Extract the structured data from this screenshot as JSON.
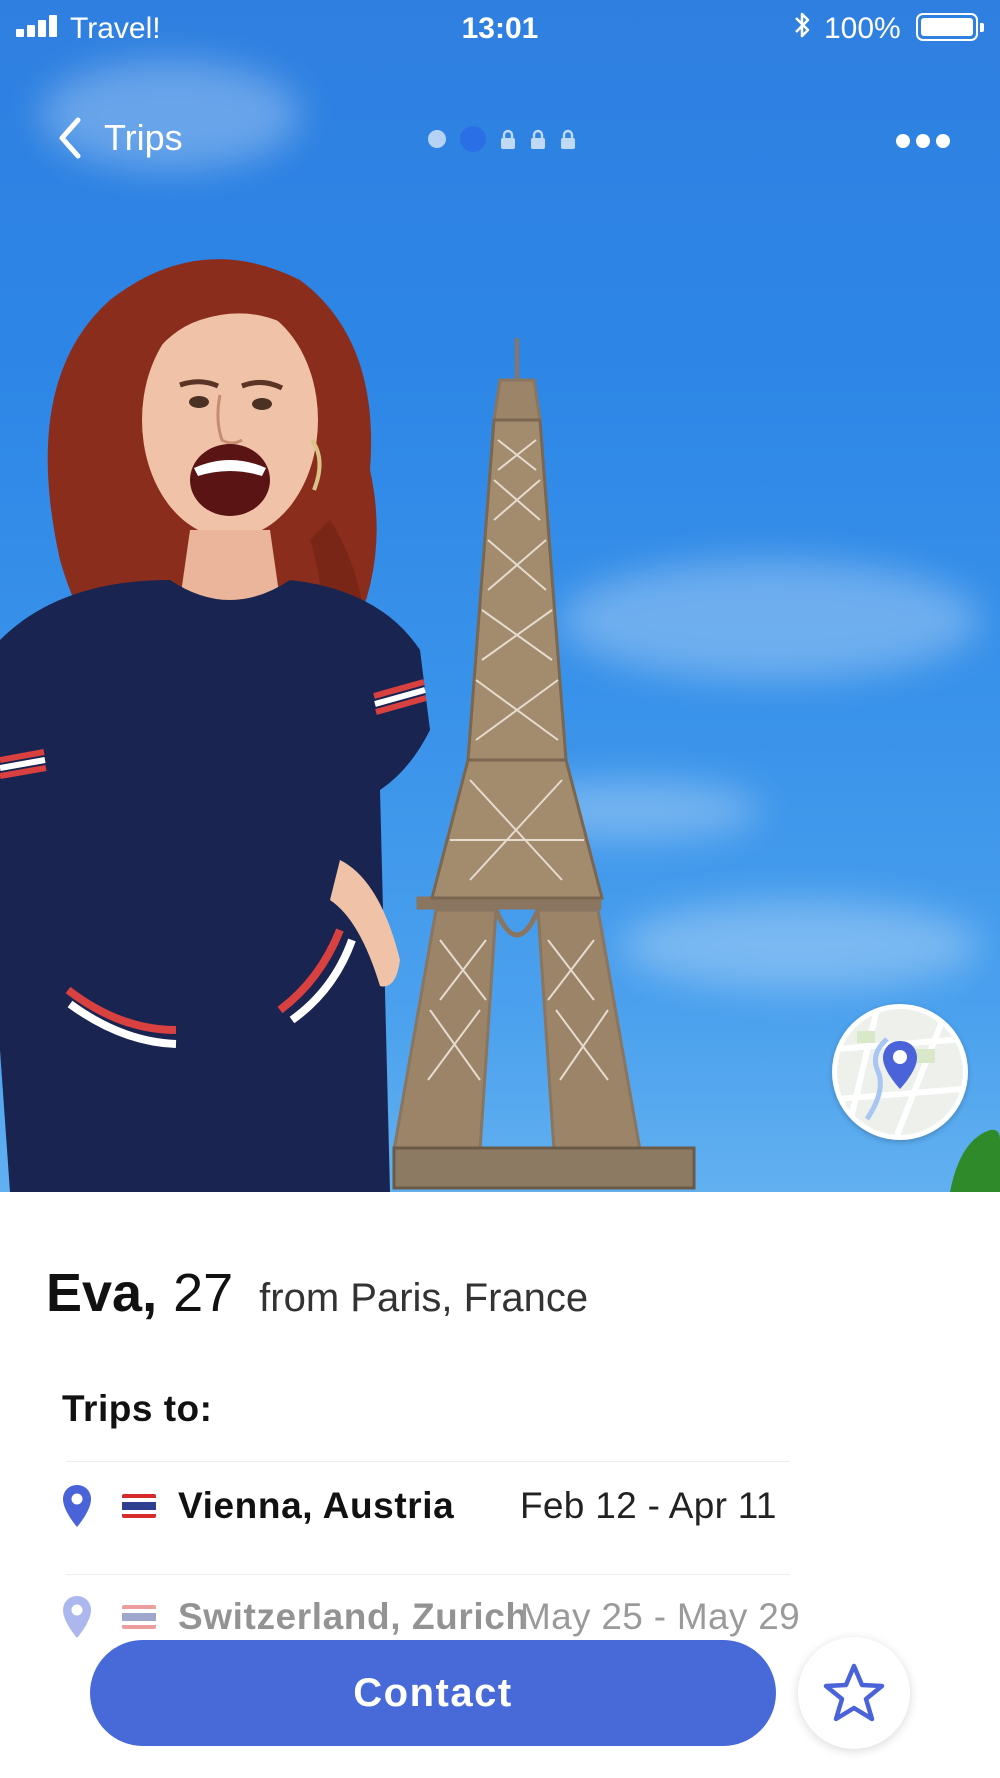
{
  "status_bar": {
    "carrier": "Travel!",
    "time": "13:01",
    "battery": "100%"
  },
  "nav": {
    "back_label": "Trips",
    "photo_count": 5,
    "active_photo_index": 2,
    "locked_photos": 3
  },
  "profile": {
    "name": "Eva,",
    "age": "27",
    "origin": "from Paris, France"
  },
  "trips": {
    "heading": "Trips to:",
    "items": [
      {
        "destination": "Vienna, Austria",
        "dates": "Feb 12 - Apr 11",
        "flag_colors": [
          "#d72b2b",
          "#ffffff",
          "#2f3e8f",
          "#ffffff",
          "#d72b2b"
        ]
      },
      {
        "destination": "Switzerland, Zurich",
        "dates": "May 25 - May 29",
        "flag_colors": [
          "#d72b2b",
          "#ffffff",
          "#2f3e8f",
          "#ffffff",
          "#d72b2b"
        ]
      }
    ]
  },
  "actions": {
    "contact_label": "Contact",
    "favorite_icon": "star-icon",
    "map_icon": "map-pin-icon"
  },
  "colors": {
    "accent": "#4869d8",
    "pin": "#4a63d9"
  }
}
